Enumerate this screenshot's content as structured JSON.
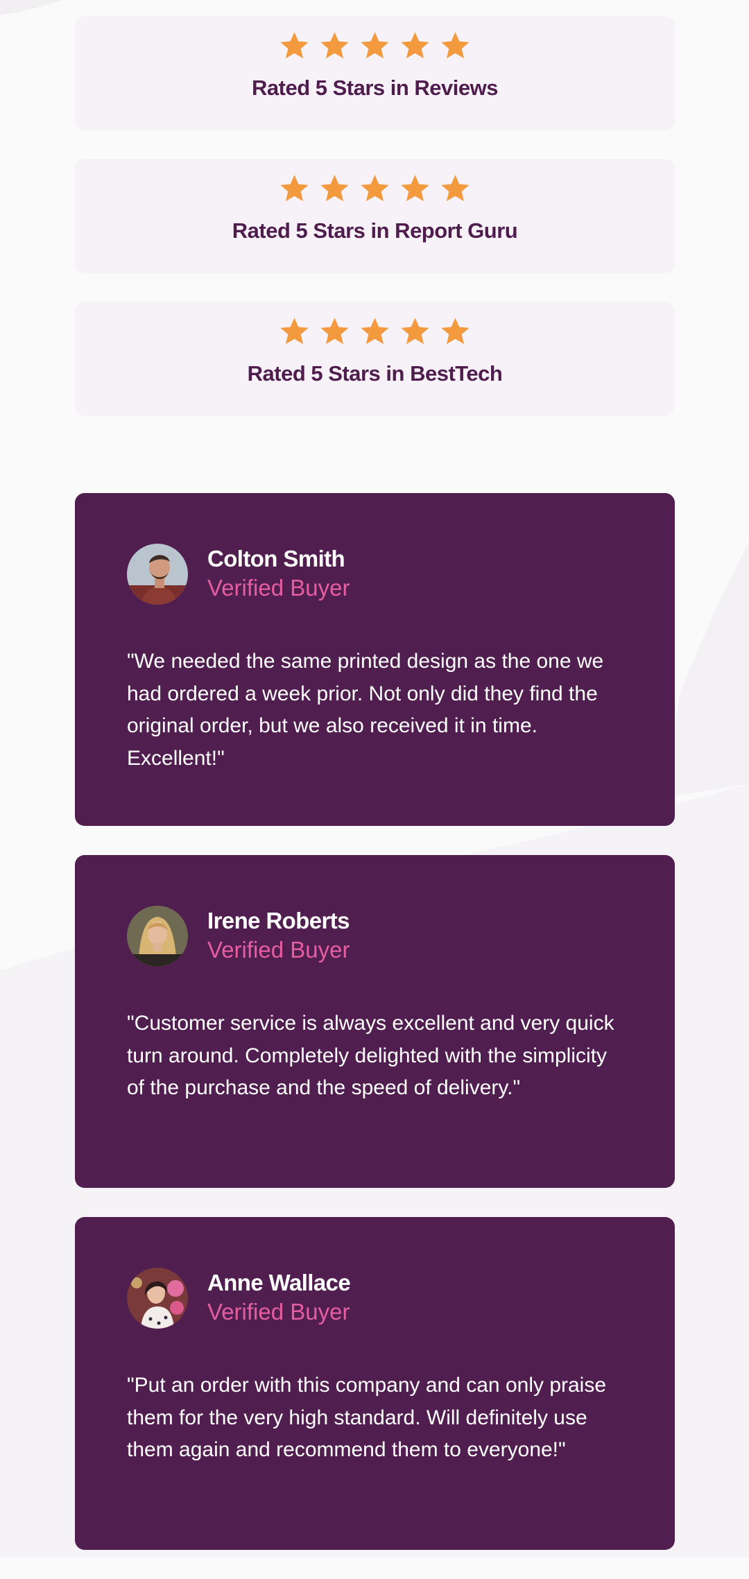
{
  "colors": {
    "star": "#f39a3e",
    "rating_card_bg": "#f7f1f8",
    "heading_text": "#4f1d4d",
    "review_card_bg": "#511e50",
    "verified": "#e45ea0"
  },
  "ratings": [
    {
      "stars": 5,
      "icon": "star-icon",
      "text": "Rated 5 Stars in Reviews"
    },
    {
      "stars": 5,
      "icon": "star-icon",
      "text": "Rated 5 Stars in Report Guru"
    },
    {
      "stars": 5,
      "icon": "star-icon",
      "text": "Rated 5 Stars in BestTech"
    }
  ],
  "reviews": [
    {
      "name": "Colton Smith",
      "status": "Verified Buyer",
      "avatar": "avatar-colton",
      "quote": "\"We needed the same printed design as the one we had ordered a week prior. Not only did they find the original order, but we also received it in time. Excellent!\""
    },
    {
      "name": "Irene Roberts",
      "status": "Verified Buyer",
      "avatar": "avatar-irene",
      "quote": "\"Customer service is always excellent and very quick turn around. Completely delighted with the simplicity of the purchase and the speed of delivery.\""
    },
    {
      "name": "Anne Wallace",
      "status": "Verified Buyer",
      "avatar": "avatar-anne",
      "quote": "\"Put an order with this company and can only praise them for the very high standard. Will definitely use them again and recommend them to everyone!\""
    }
  ]
}
